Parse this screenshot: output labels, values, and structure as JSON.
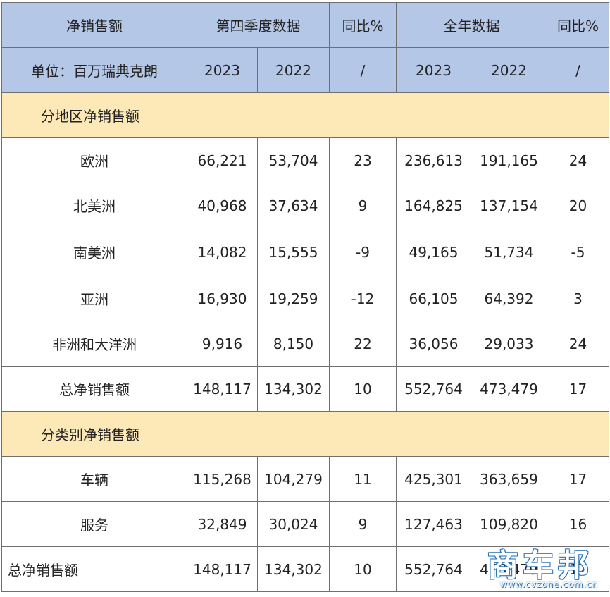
{
  "header": {
    "net_sales": "净销售额",
    "unit": "单位：百万瑞典克朗",
    "q4": "第四季度数据",
    "yoy1": "同比%",
    "full_year": "全年数据",
    "yoy2": "同比%",
    "q4_2023": "2023",
    "q4_2022": "2022",
    "slash1": "/",
    "fy_2023": "2023",
    "fy_2022": "2022",
    "slash2": "/"
  },
  "sections": [
    {
      "title": "分地区净销售额",
      "rows": [
        {
          "label": "欧洲",
          "q4_2023": "66,221",
          "q4_2022": "53,704",
          "q4_yoy": "23",
          "fy_2023": "236,613",
          "fy_2022": "191,165",
          "fy_yoy": "24"
        },
        {
          "label": "北美洲",
          "q4_2023": "40,968",
          "q4_2022": "37,634",
          "q4_yoy": "9",
          "fy_2023": "164,825",
          "fy_2022": "137,154",
          "fy_yoy": "20"
        },
        {
          "label": "南美洲",
          "q4_2023": "14,082",
          "q4_2022": "15,555",
          "q4_yoy": "-9",
          "fy_2023": "49,165",
          "fy_2022": "51,734",
          "fy_yoy": "-5"
        },
        {
          "label": "亚洲",
          "q4_2023": "16,930",
          "q4_2022": "19,259",
          "q4_yoy": "-12",
          "fy_2023": "66,105",
          "fy_2022": "64,392",
          "fy_yoy": "3"
        },
        {
          "label": "非洲和大洋洲",
          "q4_2023": "9,916",
          "q4_2022": "8,150",
          "q4_yoy": "22",
          "fy_2023": "36,056",
          "fy_2022": "29,033",
          "fy_yoy": "24"
        },
        {
          "label": "总净销售额",
          "q4_2023": "148,117",
          "q4_2022": "134,302",
          "q4_yoy": "10",
          "fy_2023": "552,764",
          "fy_2022": "473,479",
          "fy_yoy": "17"
        }
      ]
    },
    {
      "title": "分类别净销售额",
      "rows": [
        {
          "label": "车辆",
          "q4_2023": "115,268",
          "q4_2022": "104,279",
          "q4_yoy": "11",
          "fy_2023": "425,301",
          "fy_2022": "363,659",
          "fy_yoy": "17"
        },
        {
          "label": "服务",
          "q4_2023": "32,849",
          "q4_2022": "30,024",
          "q4_yoy": "9",
          "fy_2023": "127,463",
          "fy_2022": "109,820",
          "fy_yoy": "16"
        },
        {
          "label": "总净销售额",
          "q4_2023": "148,117",
          "q4_2022": "134,302",
          "q4_yoy": "10",
          "fy_2023": "552,764",
          "fy_2022": "473,479",
          "fy_yoy": "17"
        }
      ]
    }
  ],
  "watermark": {
    "brand": "商车邦",
    "url": "www.cvzone.com.cn"
  }
}
